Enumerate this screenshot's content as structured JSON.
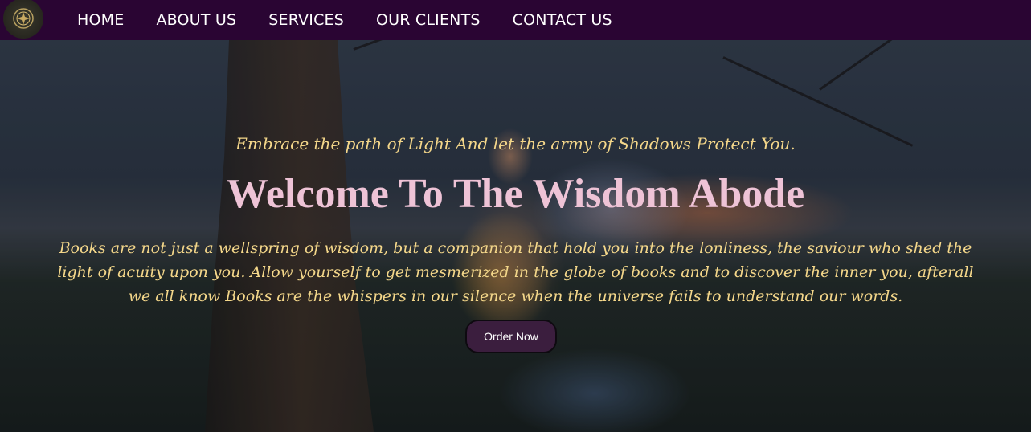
{
  "nav": {
    "logo_icon": "crest-emblem-icon",
    "items": [
      {
        "label": "HOME"
      },
      {
        "label": "ABOUT US"
      },
      {
        "label": "SERVICES"
      },
      {
        "label": "OUR CLIENTS"
      },
      {
        "label": "CONTACT US"
      }
    ]
  },
  "hero": {
    "tagline": "Embrace the path of Light And let the army of Shadows Protect You.",
    "title": "Welcome To The Wisdom Abode",
    "description": "Books are not just a wellspring of wisdom, but a companion that hold you into the lonliness, the saviour who shed the light of acuity upon you. Allow yourself to get mesmerized in the globe of books and to discover the inner you, afterall we all know Books are the whispers in our silence when the universe fails to understand our words.",
    "cta_label": "Order Now"
  },
  "colors": {
    "nav_bg": "#2a0533",
    "tagline": "#f4d78a",
    "title": "#eec3d6",
    "button_bg": "#3b1e3e"
  }
}
